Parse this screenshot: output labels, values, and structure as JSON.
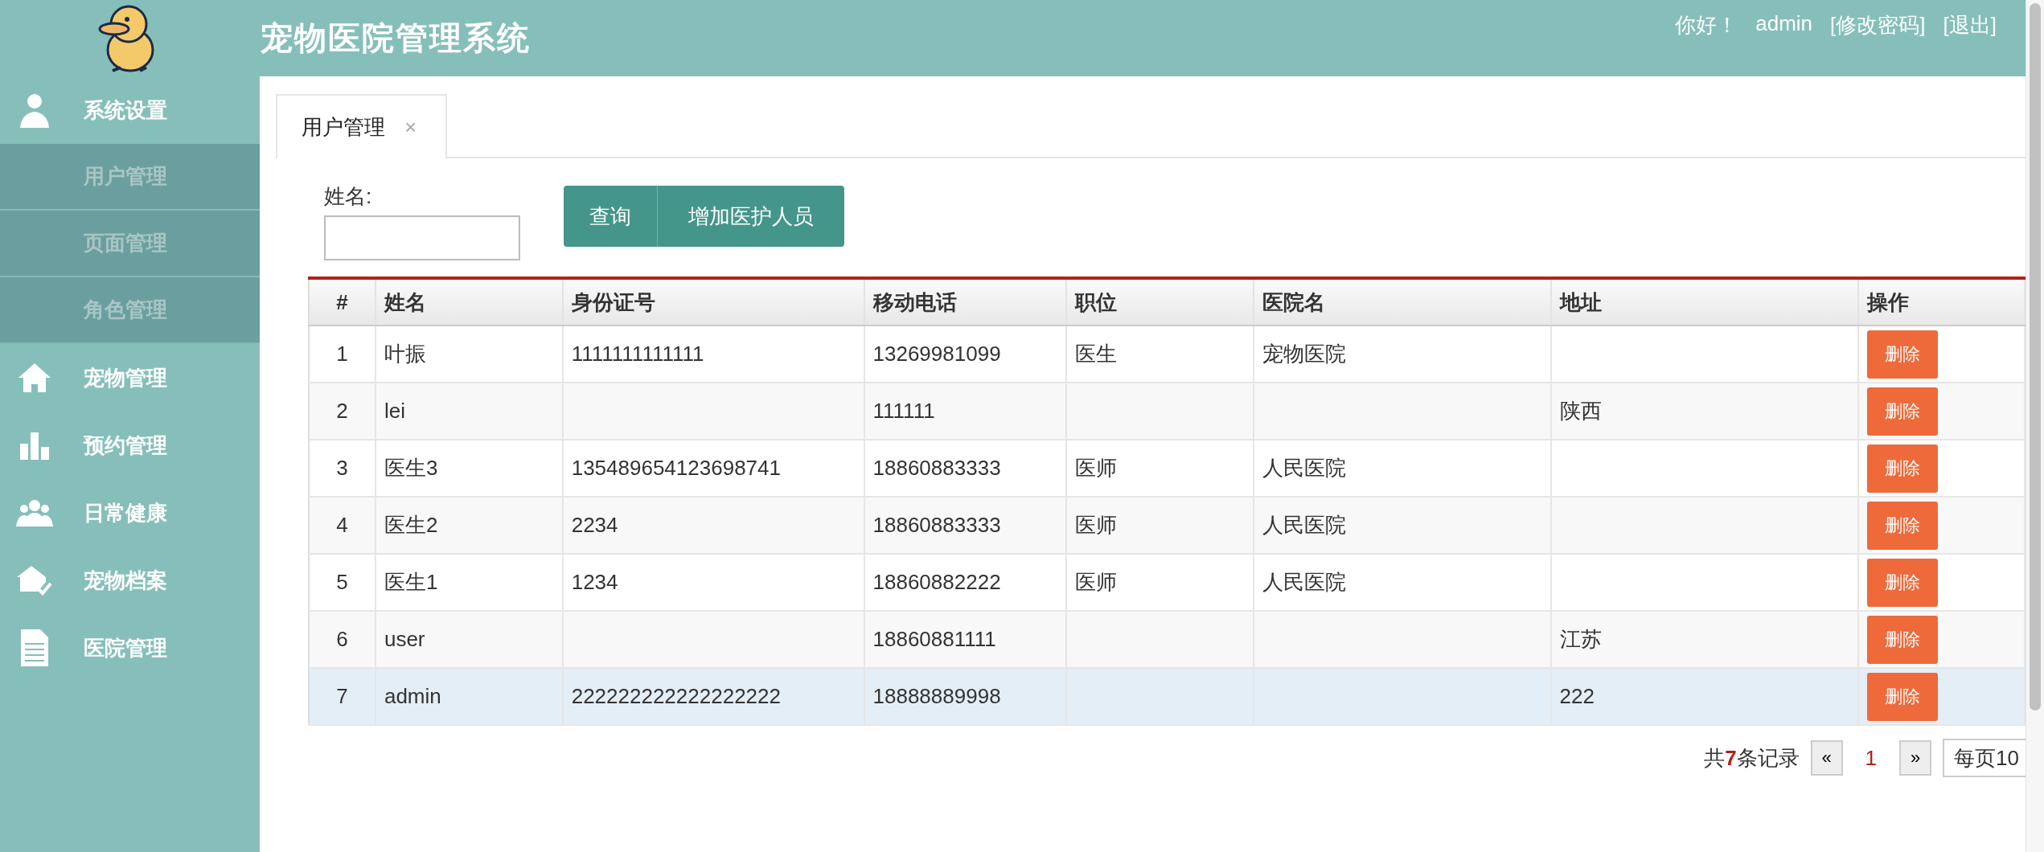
{
  "header": {
    "title": "宠物医院管理系统",
    "greeting": "你好！",
    "user": "admin",
    "links": [
      "[修改密码]",
      "[退出]"
    ]
  },
  "sidebar": {
    "items": [
      {
        "label": "系统设置",
        "children": [
          {
            "label": "用户管理"
          },
          {
            "label": "页面管理"
          },
          {
            "label": "角色管理"
          }
        ]
      },
      {
        "label": "宠物管理"
      },
      {
        "label": "预约管理"
      },
      {
        "label": "日常健康"
      },
      {
        "label": "宠物档案"
      },
      {
        "label": "医院管理"
      }
    ]
  },
  "tabs": [
    {
      "label": "用户管理",
      "close": "×",
      "selected": true
    }
  ],
  "filter": {
    "label": "姓名:",
    "buttons": [
      "查询",
      "增加医护人员"
    ]
  },
  "table": {
    "columns": [
      "#",
      "姓名",
      "身份证号",
      "移动电话",
      "职位",
      "医院名",
      "地址",
      "操作"
    ],
    "rows": [
      {
        "cells": [
          "1",
          "叶振",
          "1111111111111",
          "13269981099",
          "医生",
          "宠物医院",
          ""
        ],
        "action": "删除",
        "selected": false
      },
      {
        "cells": [
          "2",
          "lei",
          "",
          "111111",
          "",
          "",
          "陕西"
        ],
        "action": "删除",
        "selected": false
      },
      {
        "cells": [
          "3",
          "医生3",
          "135489654123698741",
          "18860883333",
          "医师",
          "人民医院",
          ""
        ],
        "action": "删除",
        "selected": false
      },
      {
        "cells": [
          "4",
          "医生2",
          "2234",
          "18860883333",
          "医师",
          "人民医院",
          ""
        ],
        "action": "删除",
        "selected": false
      },
      {
        "cells": [
          "5",
          "医生1",
          "1234",
          "18860882222",
          "医师",
          "人民医院",
          ""
        ],
        "action": "删除",
        "selected": false
      },
      {
        "cells": [
          "6",
          "user",
          "",
          "18860881111",
          "",
          "",
          "江苏"
        ],
        "action": "删除",
        "selected": false
      },
      {
        "cells": [
          "7",
          "admin",
          "222222222222222222",
          "18888889998",
          "",
          "",
          "222"
        ],
        "action": "删除",
        "selected": true
      }
    ]
  },
  "pagination": {
    "summary": "共**7**条记录",
    "prev": "«",
    "pages": [
      {
        "label": "1",
        "selected": true
      }
    ],
    "next": "»",
    "page_size": "每页10"
  }
}
